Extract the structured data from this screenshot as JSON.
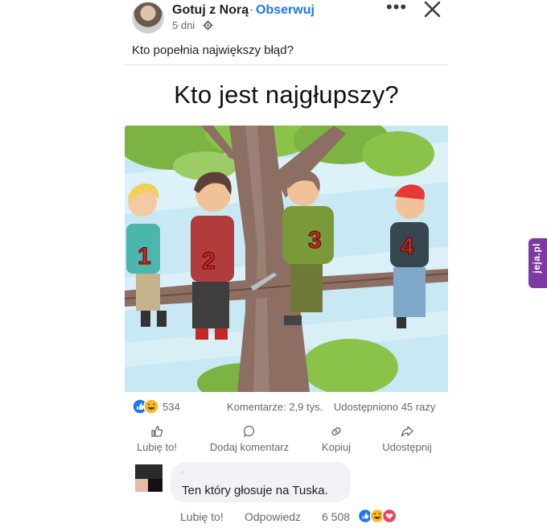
{
  "post": {
    "author": "Gotuj z Norą",
    "separator": "·",
    "follow_label": "Obserwuj",
    "time": "5 dni",
    "more_label": "•••",
    "caption": "Kto popełnia największy błąd?"
  },
  "image": {
    "headline": "Kto jest najgłupszy?",
    "numbers": [
      "1",
      "2",
      "3",
      "4"
    ]
  },
  "stats": {
    "reactions_count": "534",
    "comments": "Komentarze: 2,9 tys.",
    "shares": "Udostępniono 45 razy"
  },
  "actions": [
    {
      "label": "Lubię to!",
      "icon": "thumbs-up-icon"
    },
    {
      "label": "Dodaj komentarz",
      "icon": "comment-icon"
    },
    {
      "label": "Kopiuj",
      "icon": "link-icon"
    },
    {
      "label": "Udostępnij",
      "icon": "share-icon"
    }
  ],
  "comment": {
    "text": "Ten który głosuje na Tuska.",
    "meta_dot": "·",
    "like_label": "Lubię to!",
    "reply_label": "Odpowiedz",
    "reaction_count": "6 508"
  },
  "watermark": {
    "text": "jeja.pl"
  },
  "colors": {
    "accent": "#1877f2",
    "muted": "#65676b",
    "bubble": "#f0f2f5",
    "watermark": "#7d3aa3"
  }
}
